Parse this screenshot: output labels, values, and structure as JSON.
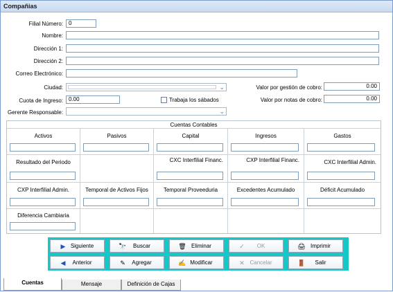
{
  "window": {
    "title": "Compañias"
  },
  "form": {
    "filial_label": "Filial Número:",
    "filial_value": "0",
    "nombre_label": "Nombre:",
    "direccion1_label": "Dirección 1:",
    "direccion2_label": "Dirección 2:",
    "correo_label": "Correo Electrónico:",
    "ciudad_label": "Ciudad:",
    "cuota_label": "Cuota de Ingreso:",
    "cuota_value": "0.00",
    "trabaja_sabados_label": "Trabaja los sábados",
    "gerente_label": "Gerente Responsable:",
    "valor_gestion_label": "Valor por gestión de cobro:",
    "valor_gestion_value": "0.00",
    "valor_notas_label": "Valor por notas de cobro:",
    "valor_notas_value": "0.00"
  },
  "cuentas": {
    "title": "Cuentas Contables",
    "row1": [
      "Activos",
      "Pasivos",
      "Capital",
      "Ingresos",
      "Gastos"
    ],
    "row2": [
      "Resultado del Periodo",
      "",
      "CXC Interfilial Financ.",
      "CXP Interfilial Financ.",
      "CXC Interfilial Admin."
    ],
    "row3": [
      "CXP Interfilial Admin.",
      "Temporal de Activos Fijos",
      "Temporal Proveeduria",
      "Excedentes Acumulado",
      "Déficit Acumulado"
    ],
    "row4": [
      "Diferencia Cambiaria"
    ]
  },
  "buttons": {
    "siguiente": "Siguiente",
    "buscar": "Buscar",
    "eliminar": "Eliminar",
    "ok": "OK",
    "imprimir": "Imprimir",
    "anterior": "Anterior",
    "agregar": "Agregar",
    "modificar": "Modificar",
    "cancelar": "Cancelar",
    "salir": "Salir"
  },
  "tabs": [
    "Cuentas",
    "Mensaje",
    "Definición de Cajas"
  ]
}
